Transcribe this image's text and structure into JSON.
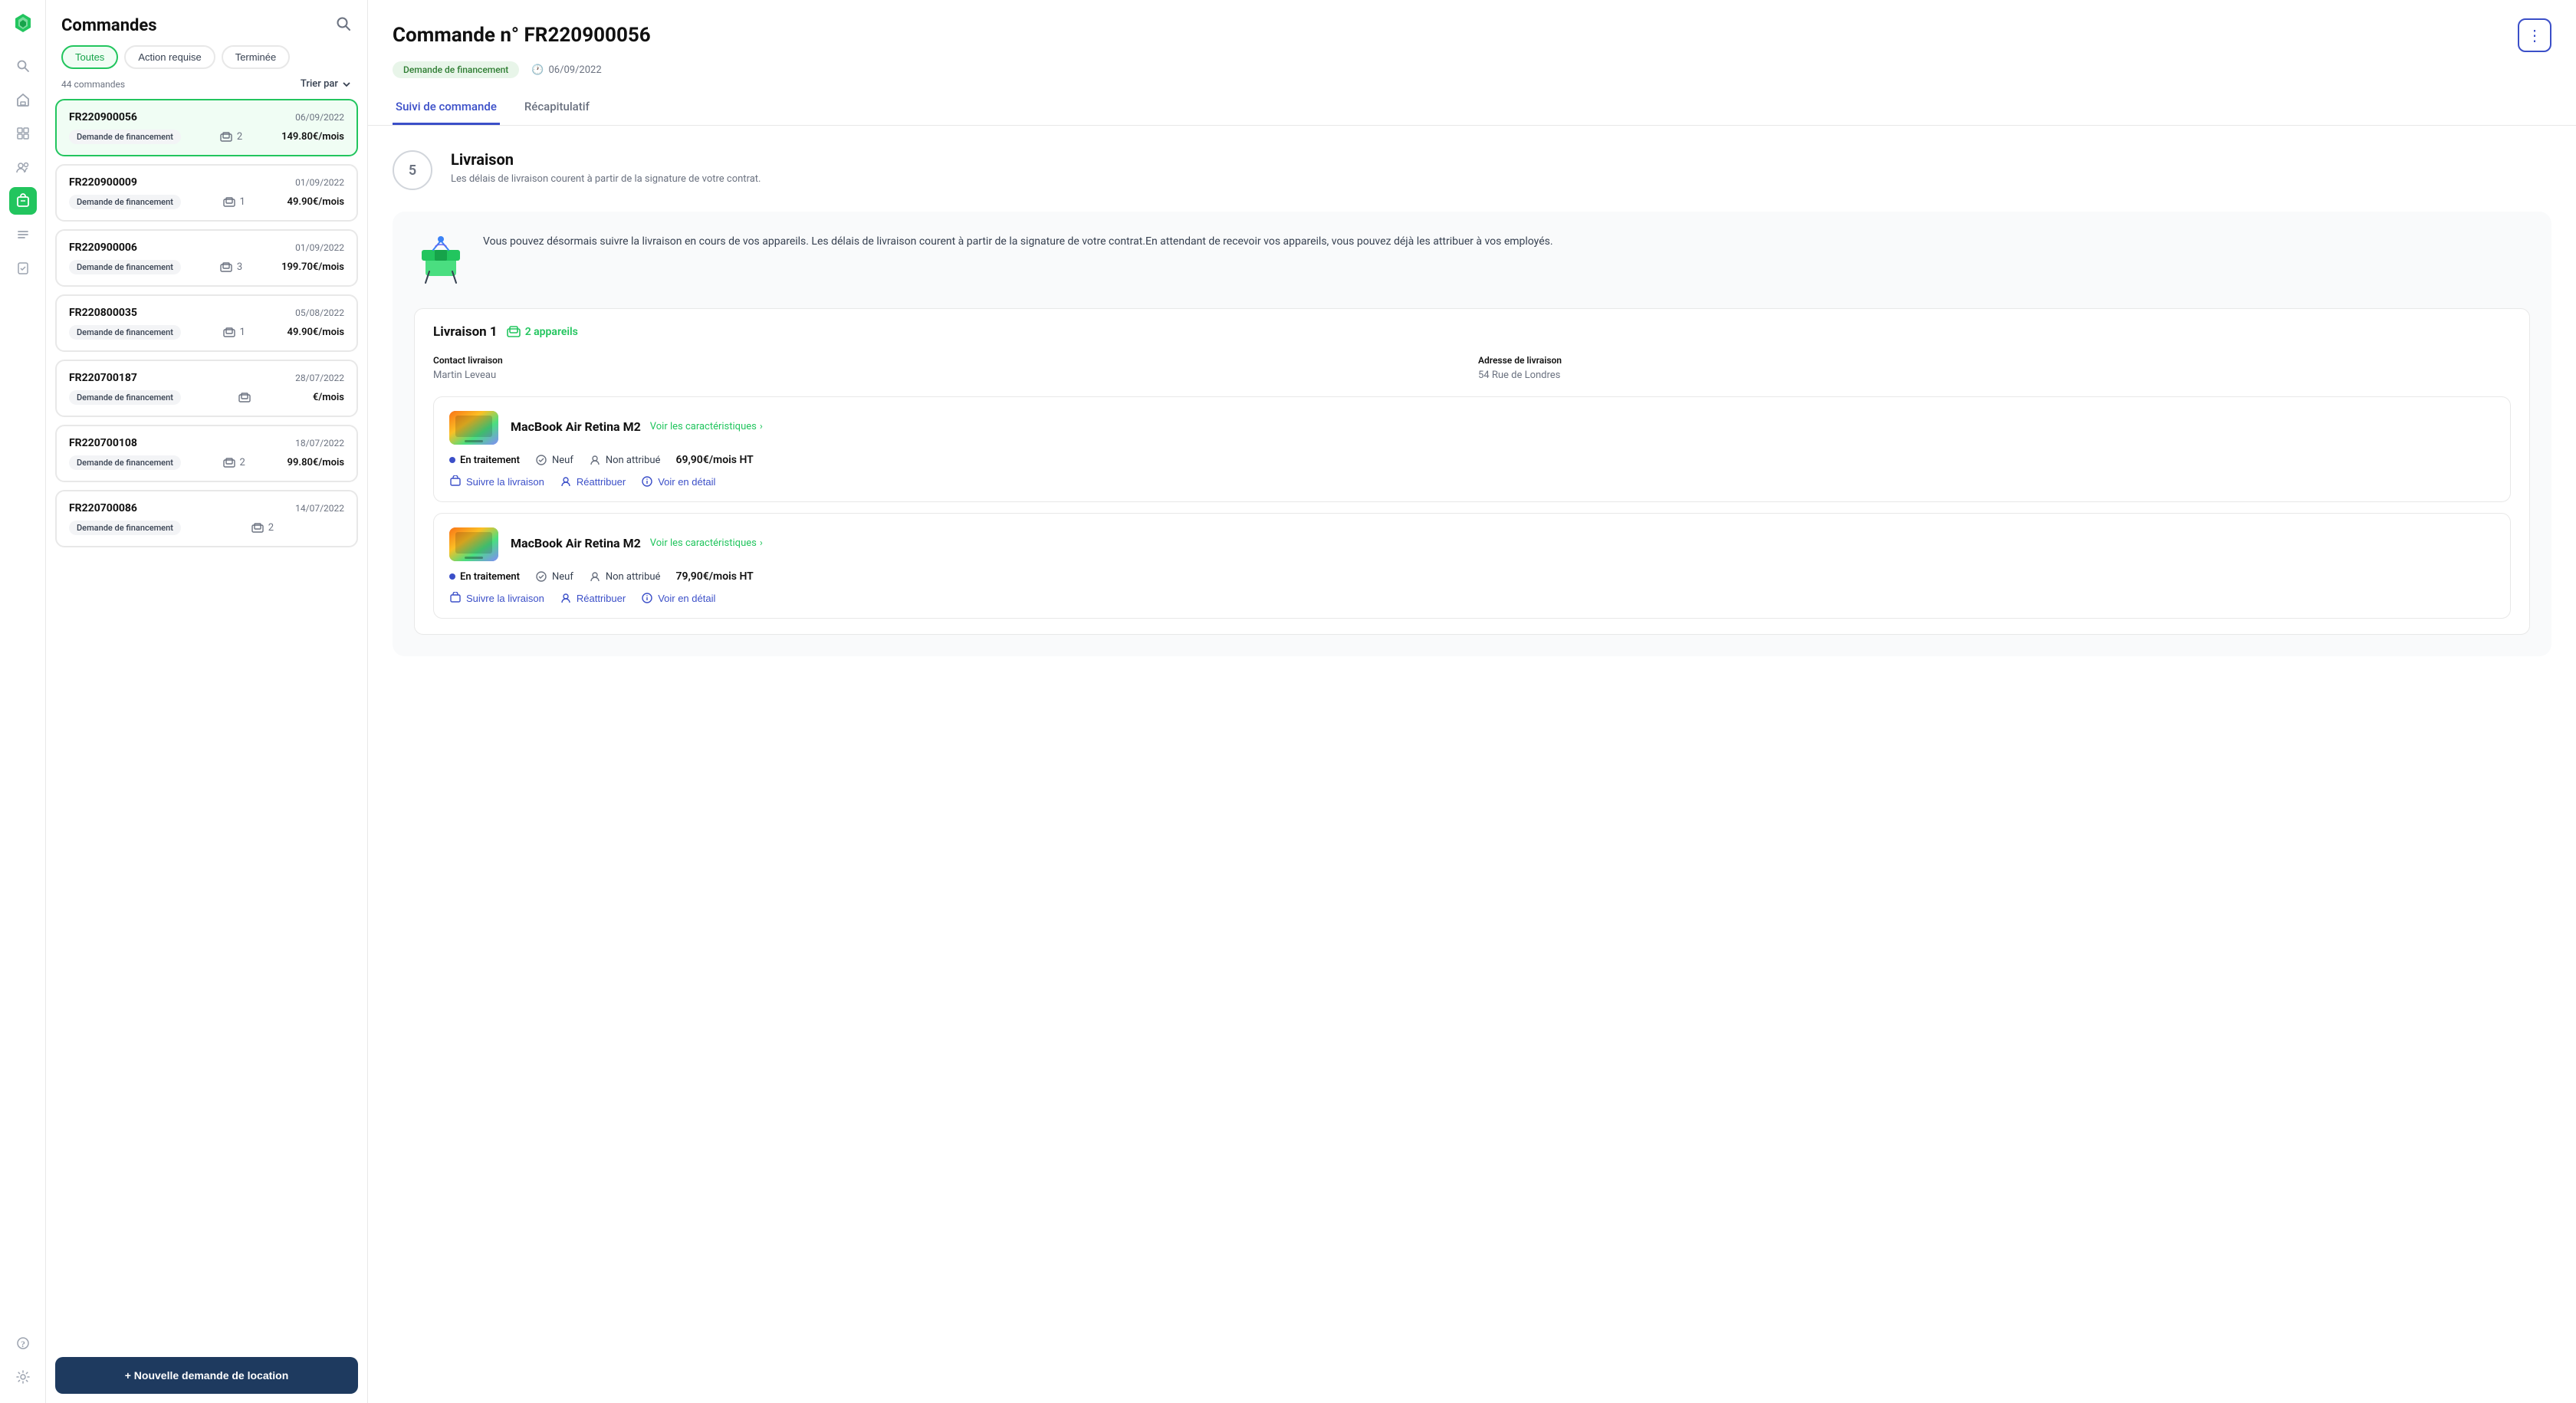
{
  "app": {
    "logo_alt": "App Logo"
  },
  "sidebar": {
    "icons": [
      {
        "name": "search-icon",
        "symbol": "🔍",
        "active": false
      },
      {
        "name": "home-icon",
        "symbol": "⊞",
        "active": false
      },
      {
        "name": "chart-icon",
        "symbol": "▦",
        "active": false
      },
      {
        "name": "team-icon",
        "symbol": "👥",
        "active": false
      },
      {
        "name": "orders-icon",
        "symbol": "📦",
        "active": true
      },
      {
        "name": "list-icon",
        "symbol": "☰",
        "active": false
      },
      {
        "name": "tasks-icon",
        "symbol": "✓",
        "active": false
      },
      {
        "name": "help-icon",
        "symbol": "?",
        "active": false
      },
      {
        "name": "settings-icon",
        "symbol": "⚙",
        "active": false
      }
    ]
  },
  "orders_panel": {
    "title": "Commandes",
    "tabs": [
      {
        "label": "Toutes",
        "active": true
      },
      {
        "label": "Action requise",
        "active": false
      },
      {
        "label": "Terminée",
        "active": false
      }
    ],
    "count_label": "44 commandes",
    "sort_label": "Trier par",
    "orders": [
      {
        "id": "FR220900056",
        "date": "06/09/2022",
        "badge": "Demande de financement",
        "devices": "2",
        "price": "149.80€/mois",
        "selected": true
      },
      {
        "id": "FR220900009",
        "date": "01/09/2022",
        "badge": "Demande de financement",
        "devices": "1",
        "price": "49.90€/mois",
        "selected": false
      },
      {
        "id": "FR220900006",
        "date": "01/09/2022",
        "badge": "Demande de financement",
        "devices": "3",
        "price": "199.70€/mois",
        "selected": false
      },
      {
        "id": "FR220800035",
        "date": "05/08/2022",
        "badge": "Demande de financement",
        "devices": "1",
        "price": "49.90€/mois",
        "selected": false
      },
      {
        "id": "FR220700187",
        "date": "28/07/2022",
        "badge": "Demande de financement",
        "devices": "",
        "price": "€/mois",
        "selected": false
      },
      {
        "id": "FR220700108",
        "date": "18/07/2022",
        "badge": "Demande de financement",
        "devices": "2",
        "price": "99.80€/mois",
        "selected": false
      },
      {
        "id": "FR220700086",
        "date": "14/07/2022",
        "badge": "Demande de financement",
        "devices": "2",
        "price": "",
        "selected": false
      }
    ],
    "new_order_btn": "+ Nouvelle demande de location"
  },
  "detail": {
    "title": "Commande n° FR220900056",
    "status_badge": "Demande de financement",
    "date_icon": "🕐",
    "date": "06/09/2022",
    "tabs": [
      {
        "label": "Suivi de commande",
        "active": true
      },
      {
        "label": "Récapitulatif",
        "active": false
      }
    ],
    "step_number": "5",
    "section_title": "Livraison",
    "section_subtitle": "Les délais de livraison courent à partir de la signature de votre contrat.",
    "notice_text": "Vous pouvez désormais suivre la livraison en cours de vos appareils. Les délais de livraison courent à partir de la signature de votre contrat.En attendant de recevoir vos appareils, vous pouvez déjà les attribuer à vos employés.",
    "livraison_title": "Livraison 1",
    "appareils_count": "2 appareils",
    "contact_label": "Contact livraison",
    "contact_name": "Martin Leveau",
    "address_label": "Adresse de livraison",
    "address_value": "54 Rue de Londres",
    "devices": [
      {
        "name": "MacBook Air Retina M2",
        "link_label": "Voir les caractéristiques",
        "status": "En traitement",
        "condition": "Neuf",
        "attribution": "Non attribué",
        "price": "69,90€/mois HT",
        "action1": "Suivre la livraison",
        "action2": "Réattribuer",
        "action3": "Voir en détail"
      },
      {
        "name": "MacBook Air Retina M2",
        "link_label": "Voir les caractéristiques",
        "status": "En traitement",
        "condition": "Neuf",
        "attribution": "Non attribué",
        "price": "79,90€/mois HT",
        "action1": "Suivre la livraison",
        "action2": "Réattribuer",
        "action3": "Voir en détail"
      }
    ]
  }
}
